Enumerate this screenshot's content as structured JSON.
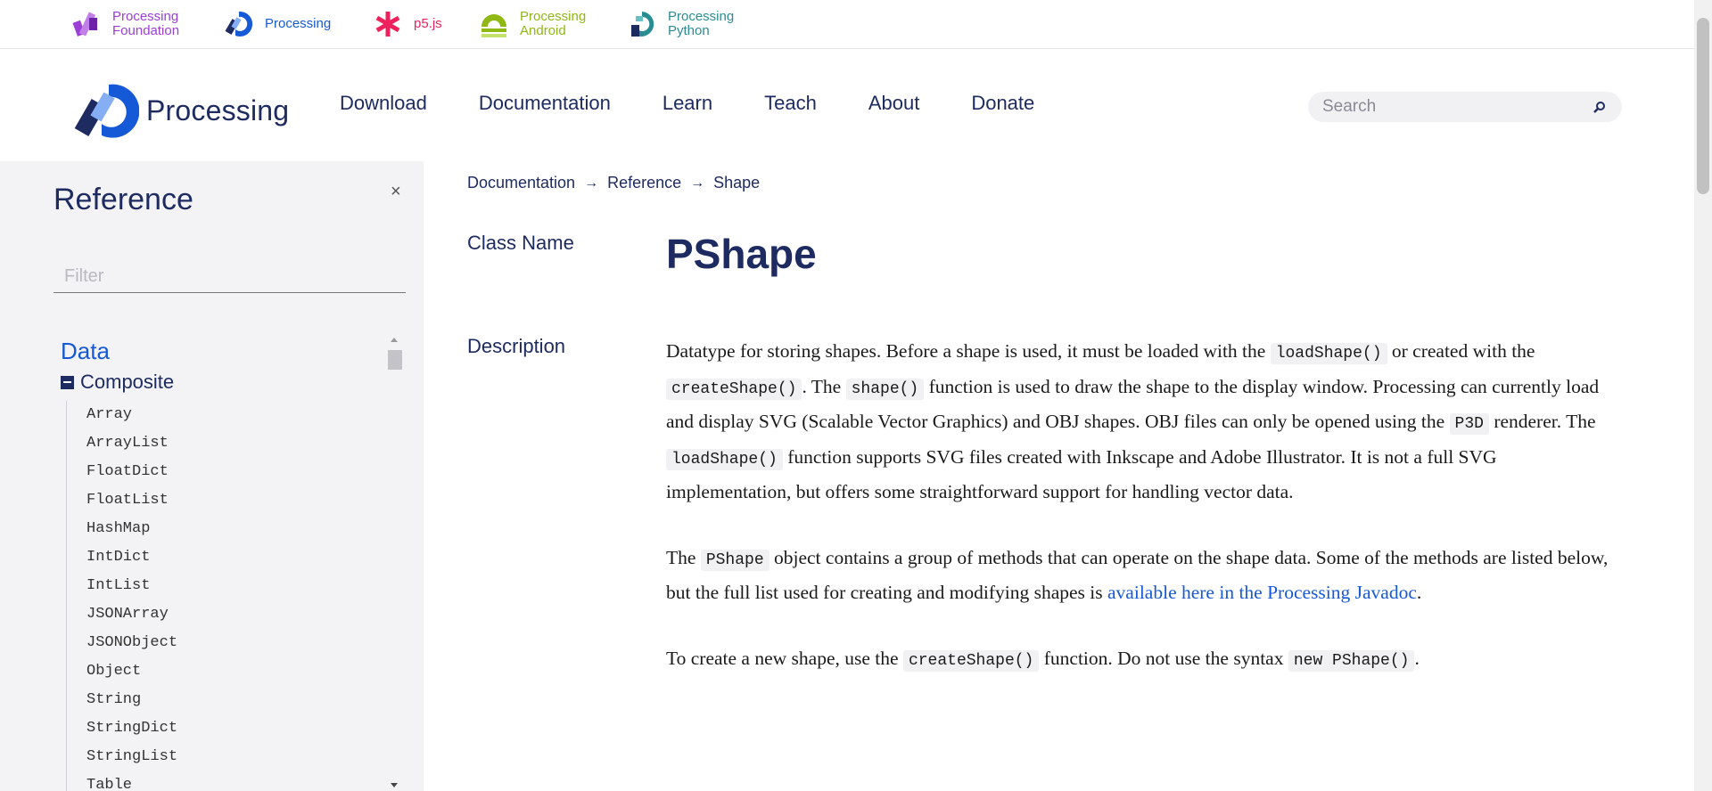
{
  "foundation_sites": [
    {
      "line1": "Processing",
      "line2": "Foundation",
      "color": "#9b3fd6",
      "icon": "processing-foundation-logo"
    },
    {
      "line1": "Processing",
      "line2": "",
      "color": "#1659d6",
      "icon": "processing-logo"
    },
    {
      "line1": "p5.js",
      "line2": "",
      "color": "#ed225d",
      "icon": "p5js-asterisk-logo"
    },
    {
      "line1": "Processing",
      "line2": "Android",
      "color": "#8fb814",
      "icon": "processing-android-logo"
    },
    {
      "line1": "Processing",
      "line2": "Python",
      "color": "#2a8c93",
      "icon": "processing-python-logo"
    }
  ],
  "header": {
    "brand": "Processing",
    "nav": [
      "Download",
      "Documentation",
      "Learn",
      "Teach",
      "About",
      "Donate"
    ],
    "search_placeholder": "Search"
  },
  "sidebar": {
    "title": "Reference",
    "close": "×",
    "filter_placeholder": "Filter",
    "category": "Data",
    "subcategory": "Composite",
    "items": [
      "Array",
      "ArrayList",
      "FloatDict",
      "FloatList",
      "HashMap",
      "IntDict",
      "IntList",
      "JSONArray",
      "JSONObject",
      "Object",
      "String",
      "StringDict",
      "StringList",
      "Table"
    ]
  },
  "breadcrumb": [
    "Documentation",
    "Reference",
    "Shape"
  ],
  "main": {
    "class_name_label": "Class Name",
    "class_name": "PShape",
    "description_label": "Description",
    "p1": {
      "t1": "Datatype for storing shapes. Before a shape is used, it must be loaded with the ",
      "c1": "loadShape()",
      "t2": " or created with the ",
      "c2": "createShape()",
      "t3": ". The ",
      "c3": "shape()",
      "t4": " function is used to draw the shape to the display window. Processing can currently load and display SVG (Scalable Vector Graphics) and OBJ shapes. OBJ files can only be opened using the ",
      "c4": "P3D",
      "t5": " renderer. The ",
      "c5": "loadShape()",
      "t6": " function supports SVG files created with Inkscape and Adobe Illustrator. It is not a full SVG implementation, but offers some straightforward support for handling vector data."
    },
    "p2": {
      "t1": "The ",
      "c1": "PShape",
      "t2": " object contains a group of methods that can operate on the shape data. Some of the methods are listed below, but the full list used for creating and modifying shapes is ",
      "link": "available here in the Processing Javadoc",
      "t3": "."
    },
    "p3": {
      "t1": "To create a new shape, use the ",
      "c1": "createShape()",
      "t2": " function. Do not use the syntax ",
      "c2": "new PShape()",
      "t3": "."
    }
  }
}
